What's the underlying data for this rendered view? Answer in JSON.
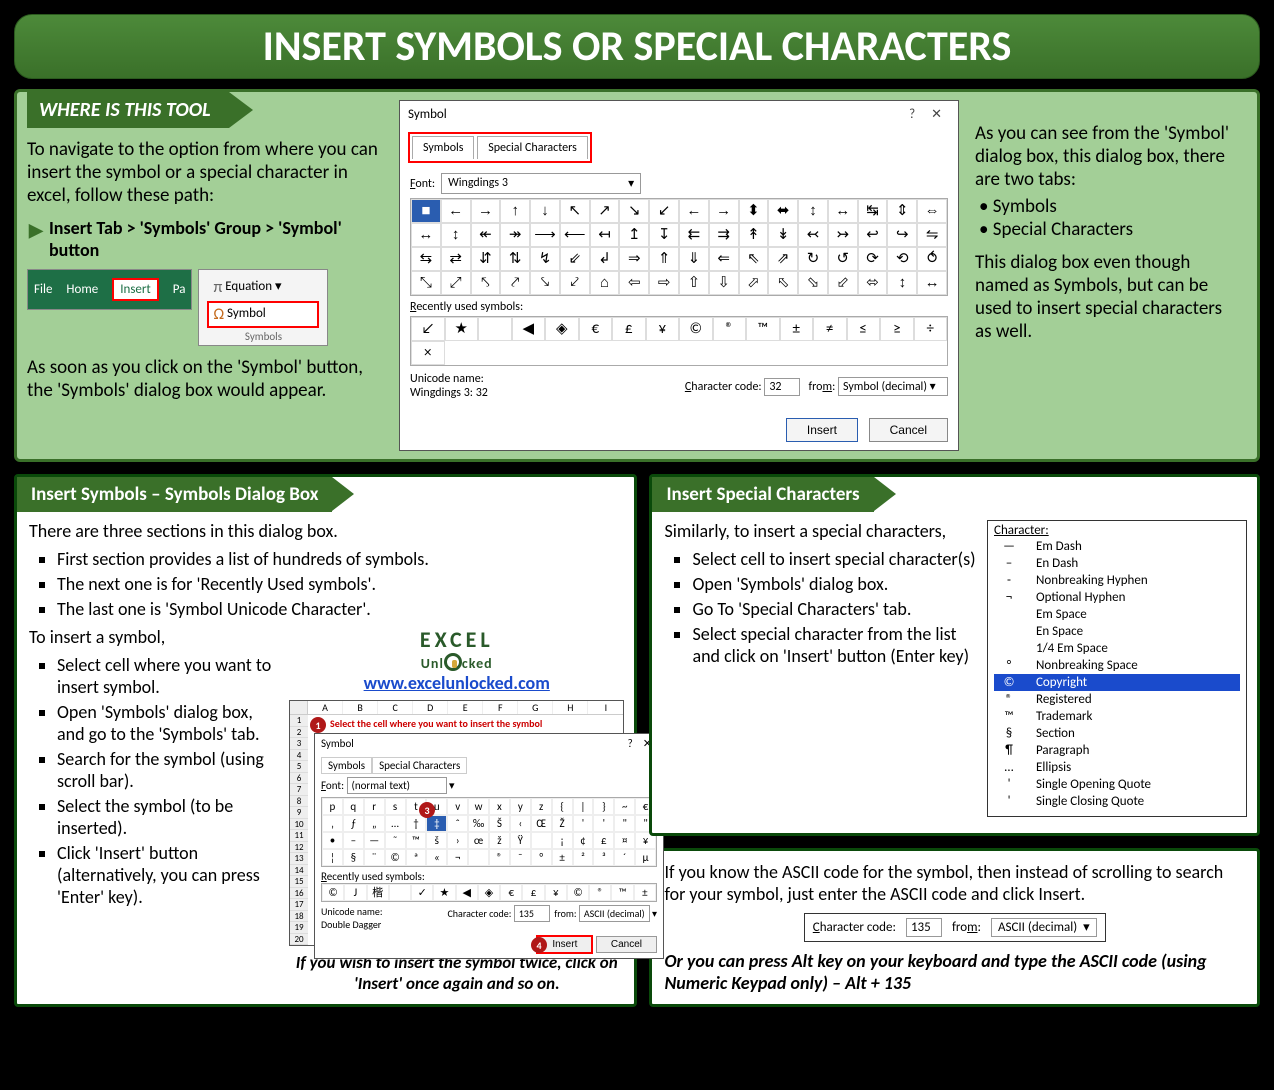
{
  "title": "INSERT SYMBOLS OR SPECIAL CHARACTERS",
  "section1": {
    "heading": "WHERE IS THIS TOOL",
    "intro": "To navigate to the option from where you can insert the symbol or a special character in excel, follow these path:",
    "path": "Insert Tab > 'Symbols' Group > 'Symbol' button",
    "excel_tabs": [
      "File",
      "Home",
      "Insert",
      "Pa"
    ],
    "sym_group": {
      "eq": "Equation",
      "sym": "Symbol",
      "lbl": "Symbols"
    },
    "after": "As soon as you click on the 'Symbol' button, the 'Symbols' dialog box would appear.",
    "right_intro": "As you can see from the 'Symbol' dialog box, this dialog box, there are two tabs:",
    "right_bullets": [
      "Symbols",
      "Special Characters"
    ],
    "right_after": "This dialog box even though named as Symbols, but can be used to insert special characters as well."
  },
  "dialog": {
    "title": "Symbol",
    "tabs": [
      "Symbols",
      "Special Characters"
    ],
    "font_label": "Font:",
    "font_value": "Wingdings 3",
    "grid": [
      [
        "■",
        "←",
        "→",
        "↑",
        "↓",
        "↖",
        "↗",
        "↘",
        "↙",
        "←",
        "→",
        "⬍",
        "⬌",
        "↕",
        "↔",
        "↹",
        "⇕",
        "⇔"
      ],
      [
        "↔",
        "↕",
        "↞",
        "↠",
        "⟶",
        "⟵",
        "↤",
        "↥",
        "↧",
        "⇇",
        "⇉",
        "↟",
        "↡",
        "↢",
        "↣",
        "↩",
        "↪",
        "⇋"
      ],
      [
        "⇆",
        "⇄",
        "⇵",
        "⇅",
        "↯",
        "⇙",
        "↲",
        "⇒",
        "⇑",
        "⇓",
        "⇐",
        "⇖",
        "⇗",
        "↻",
        "↺",
        "⟳",
        "⟲",
        "⥀"
      ],
      [
        "⤡",
        "⤢",
        "⤣",
        "⤤",
        "⤥",
        "⤦",
        "⌂",
        "⇦",
        "⇨",
        "⇧",
        "⇩",
        "⬀",
        "⬁",
        "⬂",
        "⬃",
        "⬄",
        "↕",
        "↔"
      ]
    ],
    "recent_label": "Recently used symbols:",
    "recent": [
      "↙",
      "★",
      "",
      "◀",
      "◈",
      "€",
      "£",
      "¥",
      "©",
      "®",
      "™",
      "±",
      "≠",
      "≤",
      "≥",
      "÷",
      "×"
    ],
    "unicode_label": "Unicode name:",
    "unicode_value": "Wingdings 3: 32",
    "code_label": "Character code:",
    "code_value": "32",
    "from_label": "from:",
    "from_value": "Symbol (decimal)",
    "insert_btn": "Insert",
    "cancel_btn": "Cancel"
  },
  "section2": {
    "heading": "Insert Symbols – Symbols Dialog Box",
    "p1": "There are three sections in this dialog box.",
    "bullets1": [
      "First section provides a list of hundreds of symbols.",
      "The next one is for 'Recently Used symbols'.",
      "The last one is 'Symbol Unicode Character'."
    ],
    "p2": "To insert a symbol,",
    "bullets2": [
      "Select cell where you want to insert symbol.",
      "Open 'Symbols' dialog box, and go to the 'Symbols' tab.",
      "Search for the symbol (using scroll bar).",
      "Select the symbol (to be inserted).",
      "Click 'Insert' button (alternatively, you can press 'Enter' key)."
    ],
    "logo1": "EXCEL",
    "logo2": "Unl   cked",
    "link": "www.excelunlocked.com",
    "caption": "If you wish to insert the symbol twice, click on 'Insert' once again and so on.",
    "mini": {
      "title": "Symbol",
      "red_instr": "Select the cell where you want to insert the symbol",
      "font": "(normal text)",
      "rows": [
        [
          "p",
          "q",
          "r",
          "s",
          "t",
          "u",
          "v",
          "w",
          "x",
          "y",
          "z",
          "{",
          "|",
          "}",
          "~",
          "€"
        ],
        [
          "‚",
          "ƒ",
          "„",
          "…",
          "†",
          "‡",
          "ˆ",
          "‰",
          "Š",
          "‹",
          "Œ",
          "Ž",
          "'",
          "'",
          "\"",
          "\""
        ],
        [
          "•",
          "–",
          "—",
          "˜",
          "™",
          "š",
          "›",
          "œ",
          "ž",
          "Ÿ",
          " ",
          "¡",
          "¢",
          "£",
          "¤",
          "¥"
        ],
        [
          "¦",
          "§",
          "¨",
          "©",
          "ª",
          "«",
          "¬",
          " ",
          "®",
          "¯",
          "°",
          "±",
          "²",
          "³",
          "´",
          "µ"
        ]
      ],
      "recent": [
        "©",
        "Ј",
        "楷",
        "",
        "✓",
        "★",
        "◀",
        "◈",
        "€",
        "£",
        "¥",
        "©",
        "®",
        "™",
        "±"
      ],
      "uname": "Double Dagger",
      "code": "135",
      "from": "ASCII (decimal)"
    }
  },
  "section3": {
    "heading": "Insert Special Characters",
    "p1": "Similarly, to insert a special characters,",
    "bullets": [
      "Select cell to insert special character(s)",
      "Open 'Symbols' dialog box.",
      "Go To 'Special Characters' tab.",
      "Select special character from the list and click on 'Insert' button (Enter key)"
    ],
    "list_header": "Character:",
    "list": [
      {
        "s": "—",
        "n": "Em Dash"
      },
      {
        "s": "–",
        "n": "En Dash"
      },
      {
        "s": "-",
        "n": "Nonbreaking Hyphen"
      },
      {
        "s": "¬",
        "n": "Optional Hyphen"
      },
      {
        "s": "",
        "n": "Em Space"
      },
      {
        "s": "",
        "n": "En Space"
      },
      {
        "s": "",
        "n": "1/4 Em Space"
      },
      {
        "s": "°",
        "n": "Nonbreaking Space"
      },
      {
        "s": "©",
        "n": "Copyright",
        "sel": true
      },
      {
        "s": "®",
        "n": "Registered"
      },
      {
        "s": "™",
        "n": "Trademark"
      },
      {
        "s": "§",
        "n": "Section"
      },
      {
        "s": "¶",
        "n": "Paragraph"
      },
      {
        "s": "…",
        "n": "Ellipsis"
      },
      {
        "s": "'",
        "n": "Single Opening Quote"
      },
      {
        "s": "'",
        "n": "Single Closing Quote"
      }
    ]
  },
  "section4": {
    "p1": "If you know the ASCII code for the symbol, then instead of scrolling to search for your symbol, just enter the ASCII code and click Insert.",
    "code_label": "Character code:",
    "code_value": "135",
    "from_label": "from:",
    "from_value": "ASCII (decimal)",
    "p2": "Or you can press Alt key on your keyboard and type the ASCII code (using Numeric Keypad only) – Alt + 135"
  }
}
